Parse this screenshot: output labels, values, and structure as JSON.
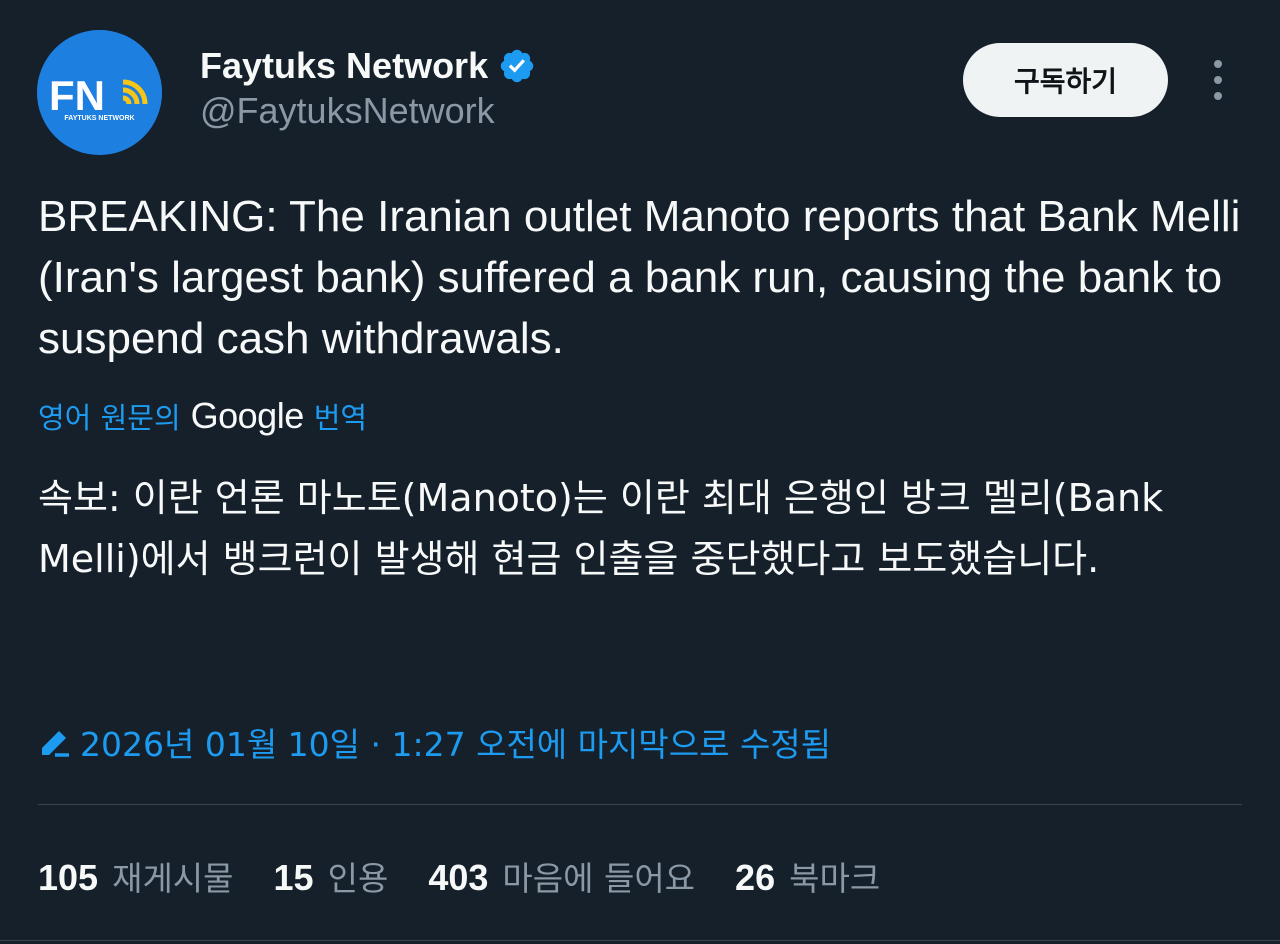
{
  "author": {
    "display_name": "Faytuks Network",
    "handle": "@FaytuksNetwork",
    "avatar_text": "FN",
    "avatar_subtext": "FAYTUKS NETWORK",
    "verified": true
  },
  "header": {
    "subscribe_label": "구독하기"
  },
  "tweet": {
    "text": "BREAKING: The Iranian outlet Manoto reports that Bank Melli (Iran's largest bank) suffered a bank run, causing the bank to suspend cash withdrawals.",
    "translate_prefix": "영어 원문의",
    "translate_brand": "Google",
    "translate_suffix": "번역",
    "translated_text": "속보: 이란 언론 마노토(Manoto)는 이란 최대 은행인 방크 멜리(Bank Melli)에서 뱅크런이 발생해 현금 인출을 중단했다고 보도했습니다.",
    "edited_text": "2026년 01월 10일 · 1:27 오전에 마지막으로 수정됨"
  },
  "stats": [
    {
      "count": "105",
      "label": "재게시물"
    },
    {
      "count": "15",
      "label": "인용"
    },
    {
      "count": "403",
      "label": "마음에 들어요"
    },
    {
      "count": "26",
      "label": "북마크"
    }
  ],
  "colors": {
    "background": "#15202b",
    "accent": "#1d9bf0",
    "text_primary": "#f7f9f9",
    "text_secondary": "#8b98a5",
    "avatar_bg": "#1d7fe0",
    "avatar_signal": "#f5c518"
  }
}
